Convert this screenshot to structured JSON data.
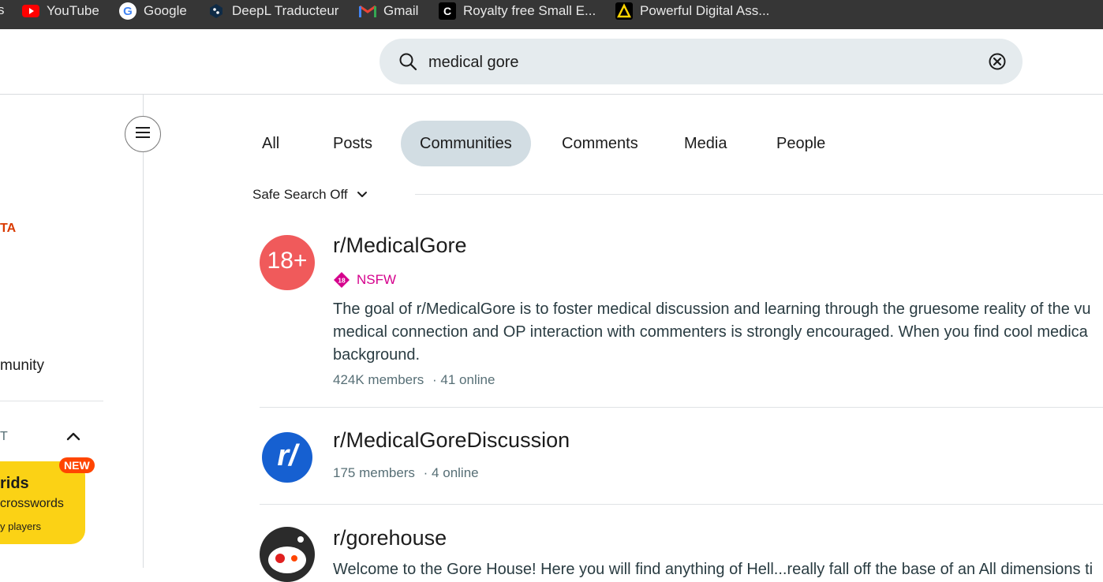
{
  "bookmarks": {
    "cut_label": "s",
    "items": [
      {
        "label": "YouTube",
        "icon": "youtube-icon"
      },
      {
        "label": "Google",
        "icon": "google-icon"
      },
      {
        "label": "DeepL Traducteur",
        "icon": "deepl-icon"
      },
      {
        "label": "Gmail",
        "icon": "gmail-icon"
      },
      {
        "label": "Royalty free Small E...",
        "icon": "royalty-icon"
      },
      {
        "label": "Powerful Digital Ass...",
        "icon": "digital-assets-icon"
      }
    ]
  },
  "search": {
    "value": "medical gore"
  },
  "sidebar": {
    "beta_label": "TA",
    "community_label": "munity",
    "section_label": "T",
    "promo": {
      "title": "rids",
      "subtitle": "crosswords",
      "caption": "y players",
      "badge": "NEW"
    }
  },
  "tabs": [
    {
      "label": "All"
    },
    {
      "label": "Posts"
    },
    {
      "label": "Communities",
      "active": true
    },
    {
      "label": "Comments"
    },
    {
      "label": "Media"
    },
    {
      "label": "People"
    }
  ],
  "safe_search": {
    "label": "Safe Search Off"
  },
  "results": [
    {
      "name": "r/MedicalGore",
      "avatar_text": "18+",
      "nsfw_label": "NSFW",
      "nsfw_badge": "18",
      "description_lines": [
        "The goal of r/MedicalGore is to foster medical discussion and learning through the gruesome reality of the vu",
        "medical connection and OP interaction with commenters is strongly encouraged. When you find cool medica",
        "background."
      ],
      "members": "424K members",
      "online": "· 41 online"
    },
    {
      "name": "r/MedicalGoreDiscussion",
      "avatar_text": "r/",
      "members": "175 members",
      "online": "· 4 online"
    },
    {
      "name": "r/gorehouse",
      "description_lines": [
        "Welcome to the Gore House! Here you will find anything of Hell...really fall off the base of an All dimensions ti"
      ]
    }
  ],
  "colors": {
    "accent": "#d2dde3",
    "nsfw": "#d5008c",
    "avatar_18": "#f05a5b",
    "avatar_r": "#1660d1",
    "promo": "#fbd215",
    "new_badge": "#ff4500"
  }
}
